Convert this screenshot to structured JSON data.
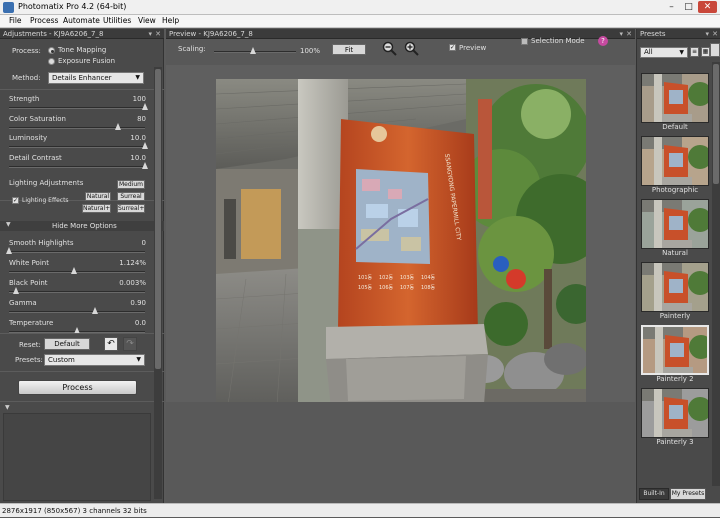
{
  "window": {
    "title": "Photomatix Pro 4.2 (64-bit)"
  },
  "menu": [
    "File",
    "Process",
    "Automate",
    "Utilities",
    "View",
    "Help"
  ],
  "adjustments": {
    "header": "Adjustments - KJ9A6206_7_8",
    "process_label": "Process:",
    "process_options": [
      "Tone Mapping",
      "Exposure Fusion"
    ],
    "method_label": "Method:",
    "method_value": "Details Enhancer",
    "sliders": [
      {
        "label": "Strength",
        "value": "100",
        "fraction": 1.0
      },
      {
        "label": "Color Saturation",
        "value": "80",
        "fraction": 0.8
      },
      {
        "label": "Luminosity",
        "value": "10.0",
        "fraction": 1.0
      },
      {
        "label": "Detail Contrast",
        "value": "10.0",
        "fraction": 1.0
      }
    ],
    "lighting": {
      "title": "Lighting Adjustments",
      "effects_label": "Lighting Effects",
      "buttons": [
        "Medium",
        "Natural",
        "Surreal",
        "Natural+",
        "Surreal+"
      ]
    },
    "more_options_label": "Hide More Options",
    "more_sliders": [
      {
        "label": "Smooth Highlights",
        "value": "0",
        "fraction": 0.0
      },
      {
        "label": "White Point",
        "value": "1.124%",
        "fraction": 0.48
      },
      {
        "label": "Black Point",
        "value": "0.003%",
        "fraction": 0.05
      },
      {
        "label": "Gamma",
        "value": "0.90",
        "fraction": 0.63
      },
      {
        "label": "Temperature",
        "value": "0.0",
        "fraction": 0.5
      }
    ],
    "reset_label": "Reset:",
    "reset_value": "Default",
    "presets_label": "Presets:",
    "presets_value": "Custom",
    "process_button": "Process"
  },
  "preview": {
    "header": "Preview - KJ9A6206_7_8",
    "scaling_label": "Scaling:",
    "scaling_value": "100%",
    "fit_label": "Fit",
    "preview_label": "Preview",
    "selection_mode_label": "Selection Mode",
    "sign_text": "SSANGYONG PAPERMILL CITY",
    "map_legend": [
      "101동",
      "102동",
      "103동",
      "104동",
      "105동",
      "106동",
      "107동",
      "108동"
    ]
  },
  "presets_panel": {
    "header": "Presets",
    "filter_value": "All",
    "items": [
      "Default",
      "Photographic",
      "Natural",
      "Painterly",
      "Painterly 2",
      "Painterly 3"
    ],
    "selected": "Painterly 2",
    "tabs": [
      "Built-In",
      "My Presets"
    ]
  },
  "status": {
    "text": "2876x1917 (850x567) 3 channels 32 bits"
  },
  "colors": {
    "accent": "#4a90d9",
    "panel": "#4a4a4a",
    "sign": "#c8502a"
  }
}
